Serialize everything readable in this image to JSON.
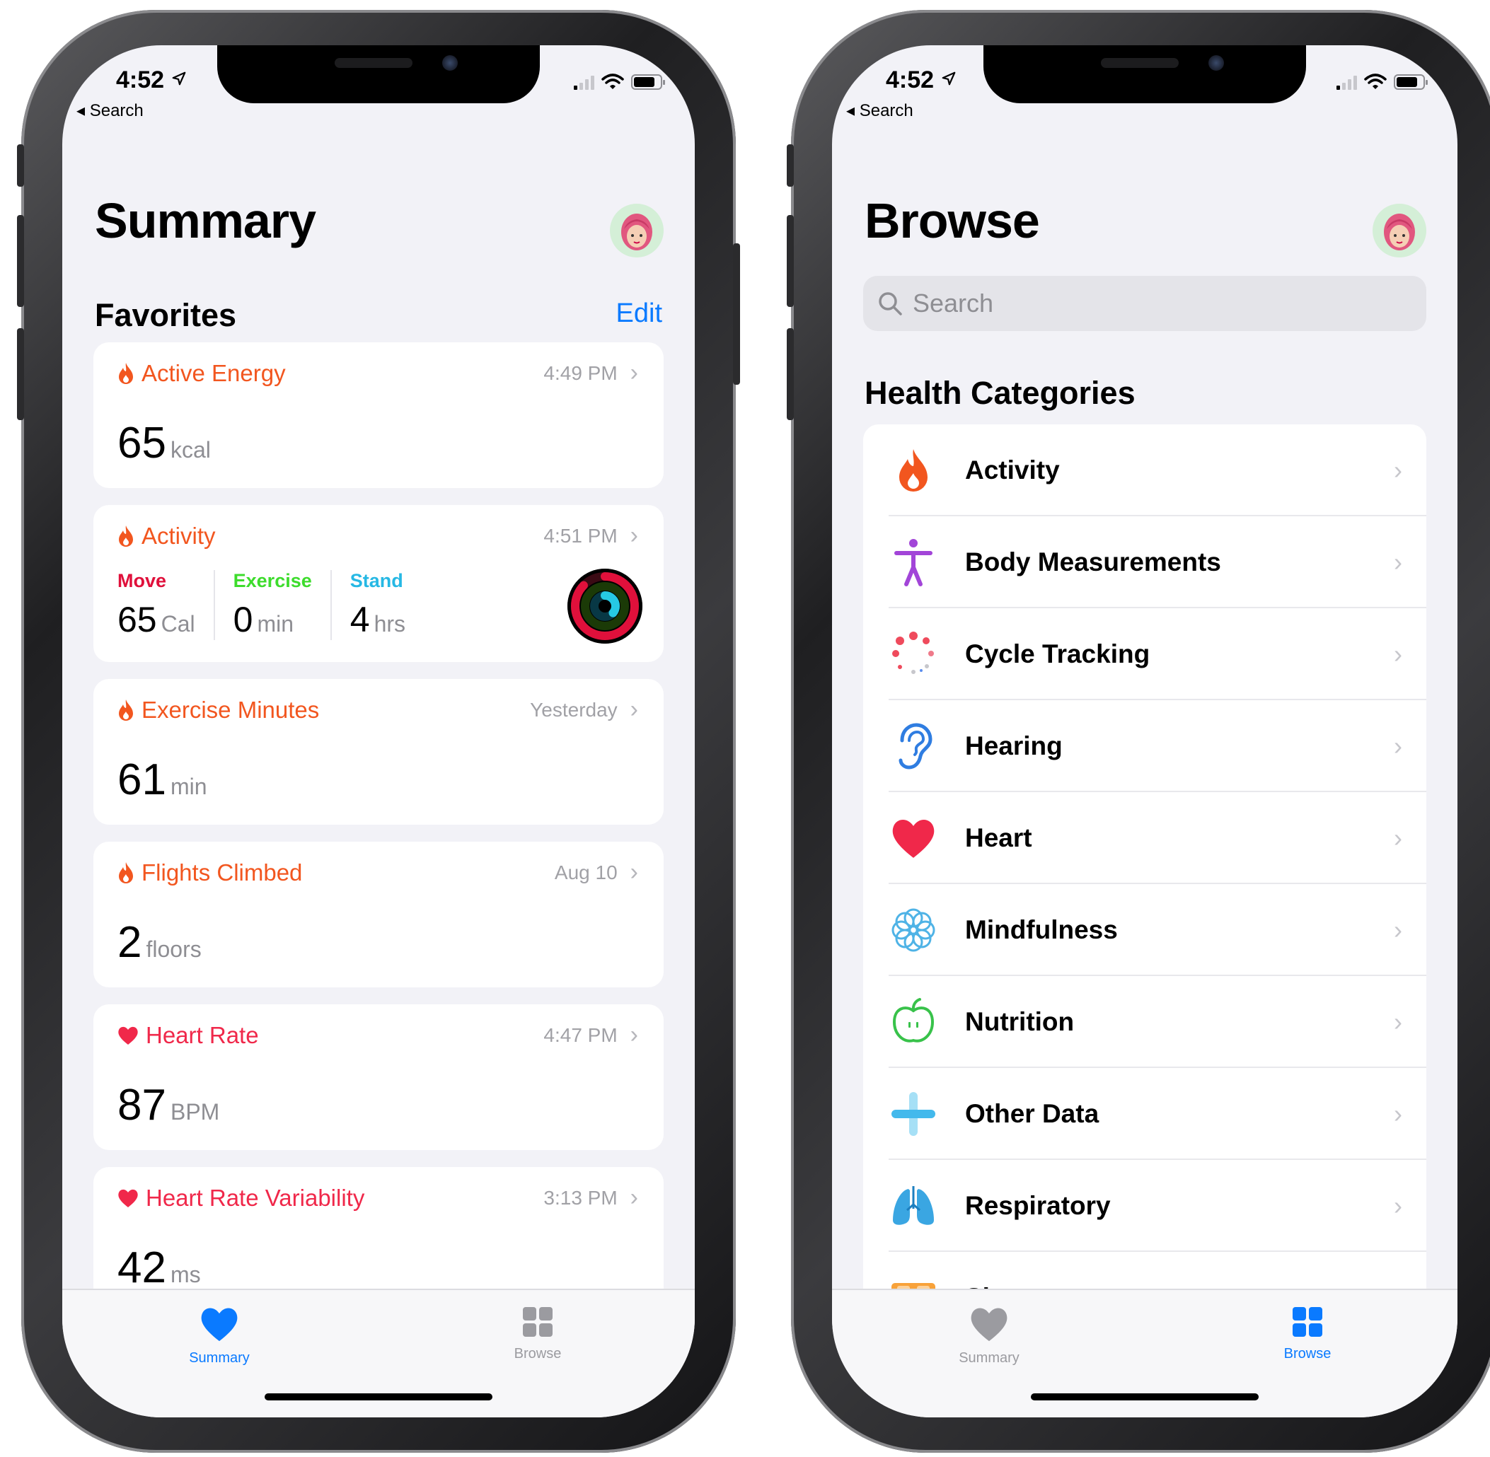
{
  "status_bar": {
    "time": "4:52",
    "back_label": "◂ Search"
  },
  "summary_screen": {
    "title": "Summary",
    "favorites_title": "Favorites",
    "edit_label": "Edit",
    "cards": {
      "active_energy": {
        "title": "Active Energy",
        "time": "4:49 PM",
        "value": "65",
        "unit": "kcal"
      },
      "activity": {
        "title": "Activity",
        "time": "4:51 PM",
        "move_label": "Move",
        "move_value": "65",
        "move_unit": "Cal",
        "exercise_label": "Exercise",
        "exercise_value": "0",
        "exercise_unit": "min",
        "stand_label": "Stand",
        "stand_value": "4",
        "stand_unit": "hrs"
      },
      "exercise_minutes": {
        "title": "Exercise Minutes",
        "time": "Yesterday",
        "value": "61",
        "unit": "min"
      },
      "flights_climbed": {
        "title": "Flights Climbed",
        "time": "Aug 10",
        "value": "2",
        "unit": "floors"
      },
      "heart_rate": {
        "title": "Heart Rate",
        "time": "4:47 PM",
        "value": "87",
        "unit": "BPM"
      },
      "hrv": {
        "title": "Heart Rate Variability",
        "time": "3:13 PM",
        "value": "42",
        "unit": "ms"
      }
    }
  },
  "browse_screen": {
    "title": "Browse",
    "search_placeholder": "Search",
    "categories_title": "Health Categories",
    "categories": [
      {
        "label": "Activity",
        "icon": "flame-icon"
      },
      {
        "label": "Body Measurements",
        "icon": "figure-icon"
      },
      {
        "label": "Cycle Tracking",
        "icon": "cycle-dots-icon"
      },
      {
        "label": "Hearing",
        "icon": "ear-icon"
      },
      {
        "label": "Heart",
        "icon": "heart-icon"
      },
      {
        "label": "Mindfulness",
        "icon": "flower-icon"
      },
      {
        "label": "Nutrition",
        "icon": "apple-icon"
      },
      {
        "label": "Other Data",
        "icon": "plus-icon"
      },
      {
        "label": "Respiratory",
        "icon": "lungs-icon"
      },
      {
        "label": "Sleep",
        "icon": "bed-icon"
      }
    ]
  },
  "tabbar": {
    "summary_label": "Summary",
    "browse_label": "Browse"
  },
  "colors": {
    "accent_blue": "#0a7aff",
    "activity_orange": "#f2561f",
    "heart_red": "#f0284a",
    "move_red": "#e0103b",
    "exercise_green": "#3ddc2c",
    "stand_cyan": "#26b8e4",
    "tab_inactive": "#9b9ba0"
  }
}
